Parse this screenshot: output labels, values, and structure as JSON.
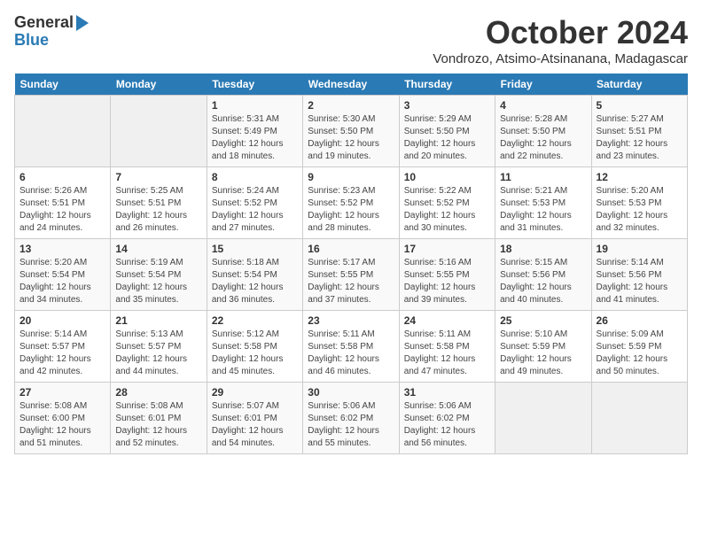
{
  "logo": {
    "line1": "General",
    "line2": "Blue"
  },
  "title": "October 2024",
  "subtitle": "Vondrozo, Atsimo-Atsinanana, Madagascar",
  "headers": [
    "Sunday",
    "Monday",
    "Tuesday",
    "Wednesday",
    "Thursday",
    "Friday",
    "Saturday"
  ],
  "weeks": [
    [
      {
        "day": "",
        "info": ""
      },
      {
        "day": "",
        "info": ""
      },
      {
        "day": "1",
        "info": "Sunrise: 5:31 AM\nSunset: 5:49 PM\nDaylight: 12 hours and 18 minutes."
      },
      {
        "day": "2",
        "info": "Sunrise: 5:30 AM\nSunset: 5:50 PM\nDaylight: 12 hours and 19 minutes."
      },
      {
        "day": "3",
        "info": "Sunrise: 5:29 AM\nSunset: 5:50 PM\nDaylight: 12 hours and 20 minutes."
      },
      {
        "day": "4",
        "info": "Sunrise: 5:28 AM\nSunset: 5:50 PM\nDaylight: 12 hours and 22 minutes."
      },
      {
        "day": "5",
        "info": "Sunrise: 5:27 AM\nSunset: 5:51 PM\nDaylight: 12 hours and 23 minutes."
      }
    ],
    [
      {
        "day": "6",
        "info": "Sunrise: 5:26 AM\nSunset: 5:51 PM\nDaylight: 12 hours and 24 minutes."
      },
      {
        "day": "7",
        "info": "Sunrise: 5:25 AM\nSunset: 5:51 PM\nDaylight: 12 hours and 26 minutes."
      },
      {
        "day": "8",
        "info": "Sunrise: 5:24 AM\nSunset: 5:52 PM\nDaylight: 12 hours and 27 minutes."
      },
      {
        "day": "9",
        "info": "Sunrise: 5:23 AM\nSunset: 5:52 PM\nDaylight: 12 hours and 28 minutes."
      },
      {
        "day": "10",
        "info": "Sunrise: 5:22 AM\nSunset: 5:52 PM\nDaylight: 12 hours and 30 minutes."
      },
      {
        "day": "11",
        "info": "Sunrise: 5:21 AM\nSunset: 5:53 PM\nDaylight: 12 hours and 31 minutes."
      },
      {
        "day": "12",
        "info": "Sunrise: 5:20 AM\nSunset: 5:53 PM\nDaylight: 12 hours and 32 minutes."
      }
    ],
    [
      {
        "day": "13",
        "info": "Sunrise: 5:20 AM\nSunset: 5:54 PM\nDaylight: 12 hours and 34 minutes."
      },
      {
        "day": "14",
        "info": "Sunrise: 5:19 AM\nSunset: 5:54 PM\nDaylight: 12 hours and 35 minutes."
      },
      {
        "day": "15",
        "info": "Sunrise: 5:18 AM\nSunset: 5:54 PM\nDaylight: 12 hours and 36 minutes."
      },
      {
        "day": "16",
        "info": "Sunrise: 5:17 AM\nSunset: 5:55 PM\nDaylight: 12 hours and 37 minutes."
      },
      {
        "day": "17",
        "info": "Sunrise: 5:16 AM\nSunset: 5:55 PM\nDaylight: 12 hours and 39 minutes."
      },
      {
        "day": "18",
        "info": "Sunrise: 5:15 AM\nSunset: 5:56 PM\nDaylight: 12 hours and 40 minutes."
      },
      {
        "day": "19",
        "info": "Sunrise: 5:14 AM\nSunset: 5:56 PM\nDaylight: 12 hours and 41 minutes."
      }
    ],
    [
      {
        "day": "20",
        "info": "Sunrise: 5:14 AM\nSunset: 5:57 PM\nDaylight: 12 hours and 42 minutes."
      },
      {
        "day": "21",
        "info": "Sunrise: 5:13 AM\nSunset: 5:57 PM\nDaylight: 12 hours and 44 minutes."
      },
      {
        "day": "22",
        "info": "Sunrise: 5:12 AM\nSunset: 5:58 PM\nDaylight: 12 hours and 45 minutes."
      },
      {
        "day": "23",
        "info": "Sunrise: 5:11 AM\nSunset: 5:58 PM\nDaylight: 12 hours and 46 minutes."
      },
      {
        "day": "24",
        "info": "Sunrise: 5:11 AM\nSunset: 5:58 PM\nDaylight: 12 hours and 47 minutes."
      },
      {
        "day": "25",
        "info": "Sunrise: 5:10 AM\nSunset: 5:59 PM\nDaylight: 12 hours and 49 minutes."
      },
      {
        "day": "26",
        "info": "Sunrise: 5:09 AM\nSunset: 5:59 PM\nDaylight: 12 hours and 50 minutes."
      }
    ],
    [
      {
        "day": "27",
        "info": "Sunrise: 5:08 AM\nSunset: 6:00 PM\nDaylight: 12 hours and 51 minutes."
      },
      {
        "day": "28",
        "info": "Sunrise: 5:08 AM\nSunset: 6:01 PM\nDaylight: 12 hours and 52 minutes."
      },
      {
        "day": "29",
        "info": "Sunrise: 5:07 AM\nSunset: 6:01 PM\nDaylight: 12 hours and 54 minutes."
      },
      {
        "day": "30",
        "info": "Sunrise: 5:06 AM\nSunset: 6:02 PM\nDaylight: 12 hours and 55 minutes."
      },
      {
        "day": "31",
        "info": "Sunrise: 5:06 AM\nSunset: 6:02 PM\nDaylight: 12 hours and 56 minutes."
      },
      {
        "day": "",
        "info": ""
      },
      {
        "day": "",
        "info": ""
      }
    ]
  ]
}
